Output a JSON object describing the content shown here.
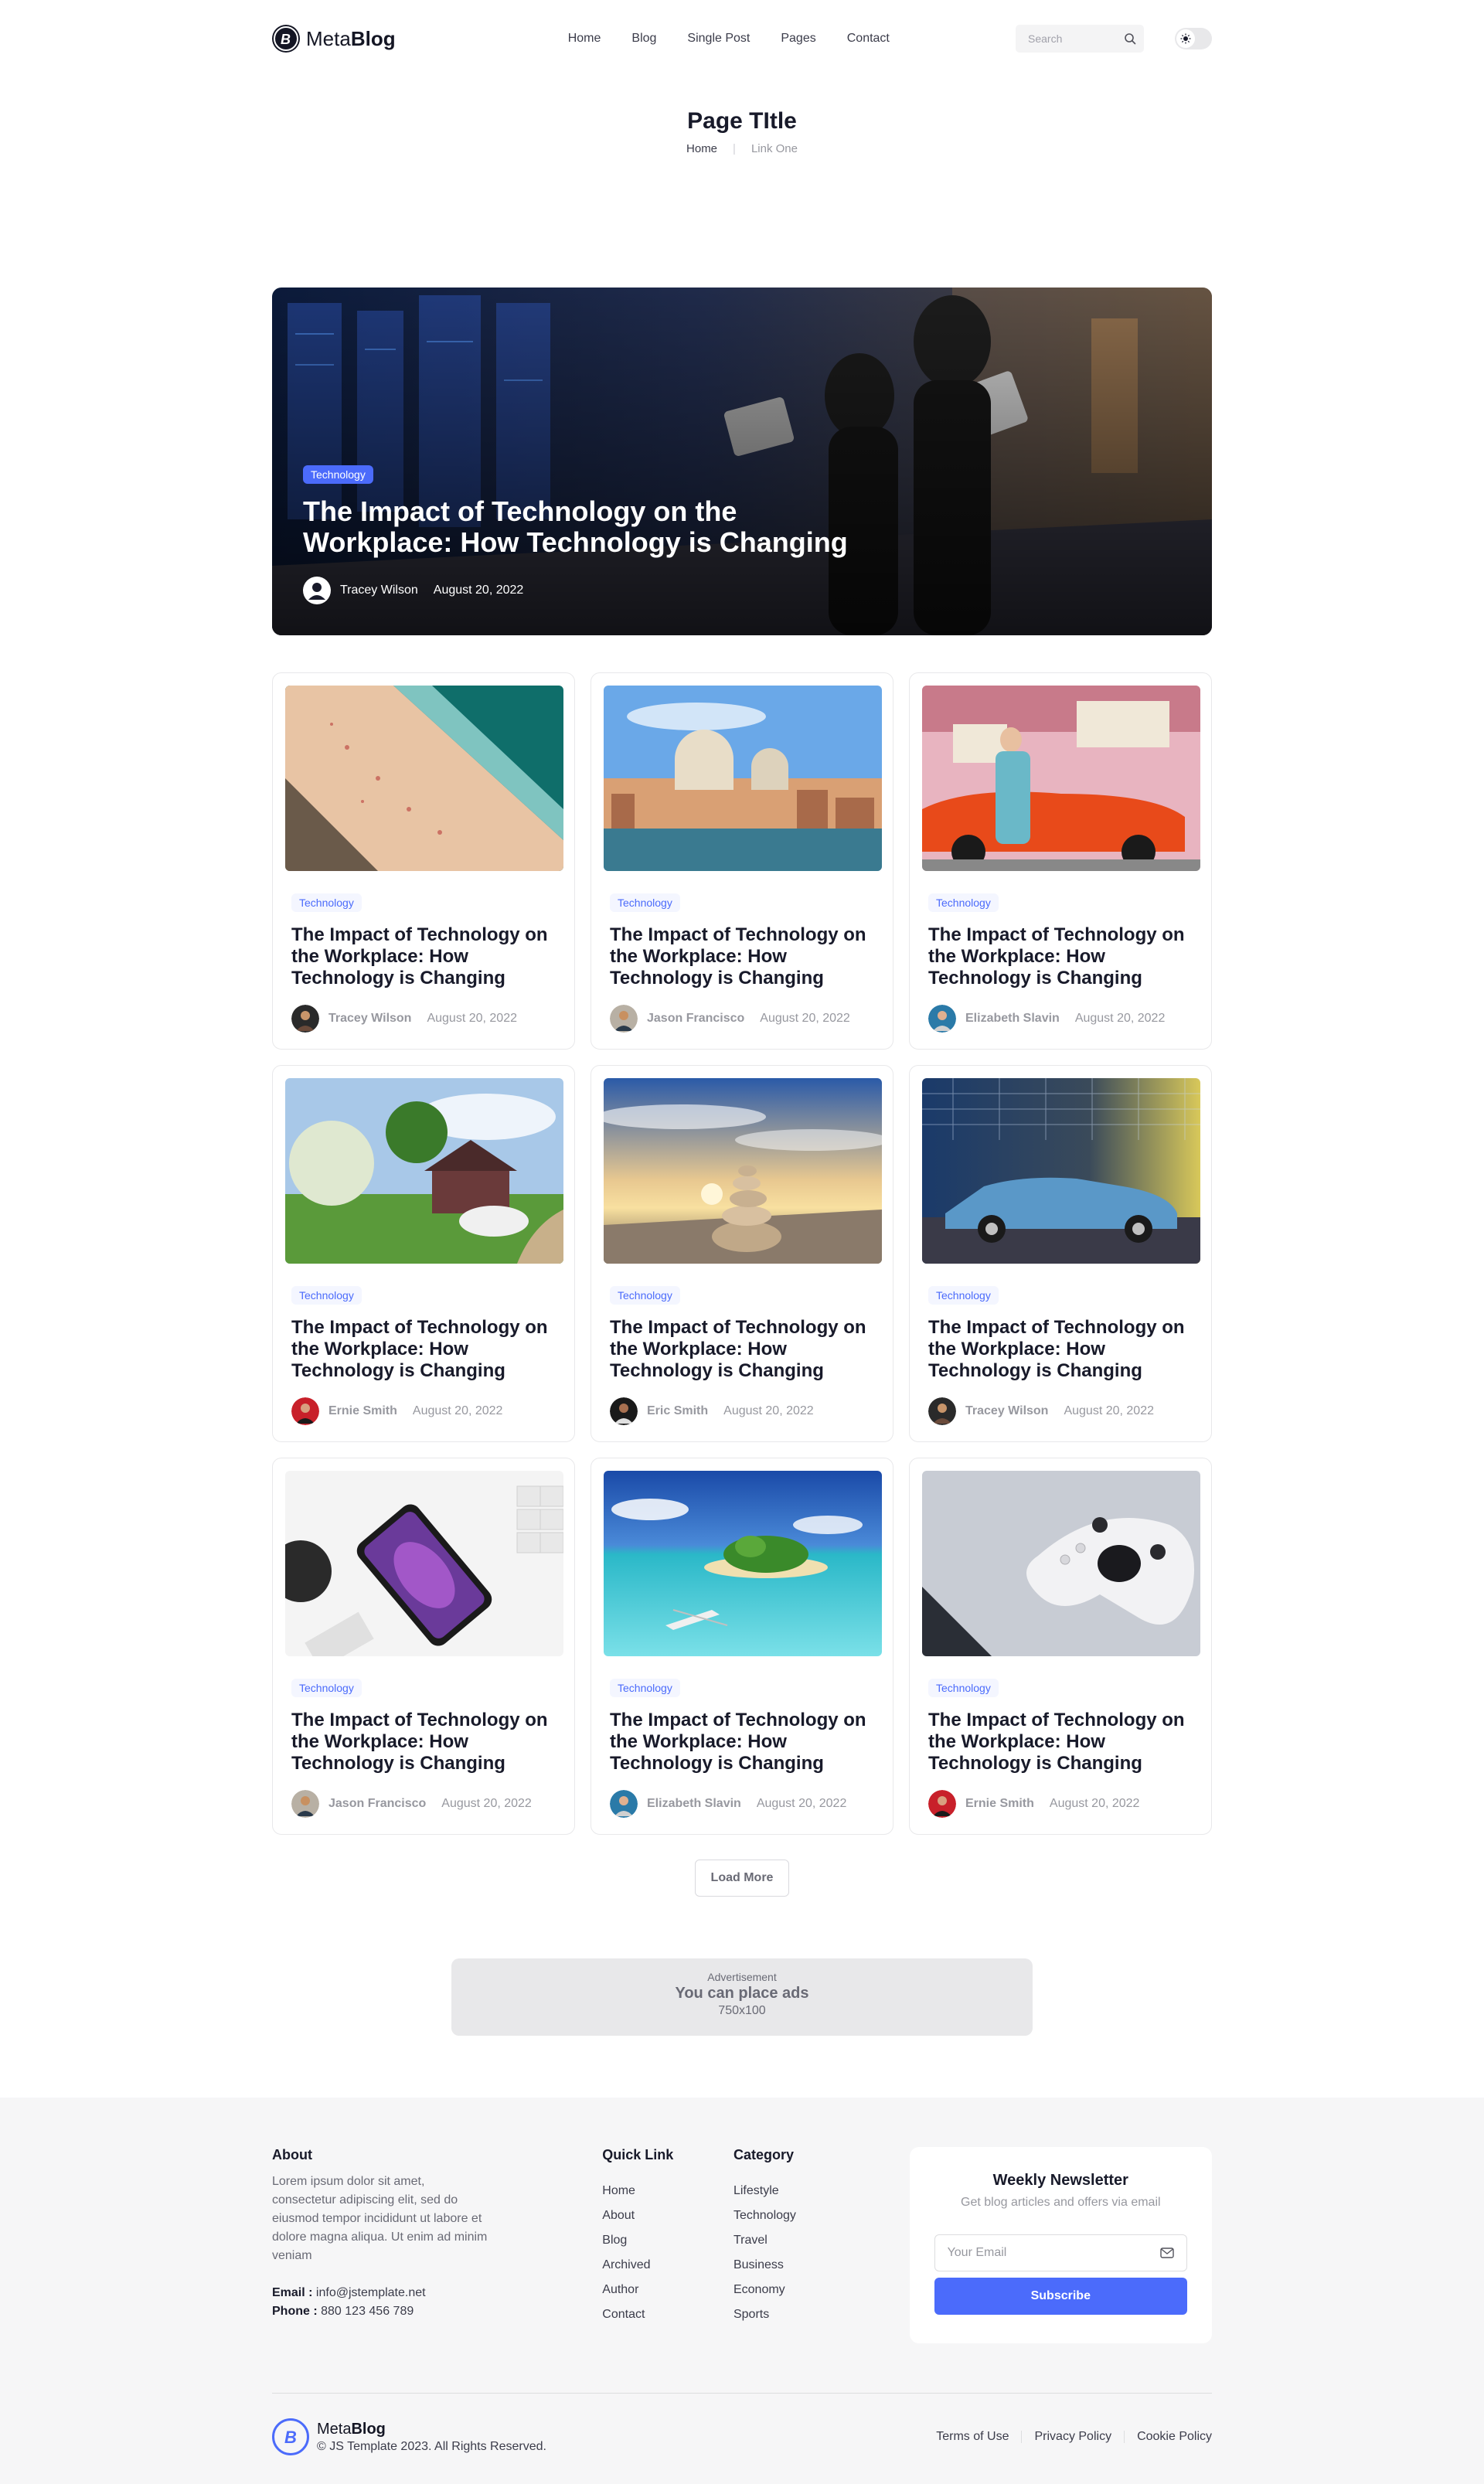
{
  "header": {
    "logo_light": "Meta",
    "logo_bold": "Blog",
    "nav": [
      "Home",
      "Blog",
      "Single Post",
      "Pages",
      "Contact"
    ],
    "search_placeholder": "Search"
  },
  "page": {
    "title": "Page TItle",
    "breadcrumb_current": "Home",
    "breadcrumb_link": "Link One"
  },
  "hero": {
    "tag": "Technology",
    "title": "The Impact of Technology on the Workplace: How Technology is Changing",
    "author": "Tracey Wilson",
    "date": "August 20, 2022"
  },
  "cards": [
    {
      "tag": "Technology",
      "title": "The Impact of Technology on the Workplace: How Technology is Changing",
      "author": "Tracey Wilson",
      "date": "August 20, 2022"
    },
    {
      "tag": "Technology",
      "title": "The Impact of Technology on the Workplace: How Technology is Changing",
      "author": "Jason Francisco",
      "date": "August 20, 2022"
    },
    {
      "tag": "Technology",
      "title": "The Impact of Technology on the Workplace: How Technology is Changing",
      "author": "Elizabeth Slavin",
      "date": "August 20, 2022"
    },
    {
      "tag": "Technology",
      "title": "The Impact of Technology on the Workplace: How Technology is Changing",
      "author": "Ernie Smith",
      "date": "August 20, 2022"
    },
    {
      "tag": "Technology",
      "title": "The Impact of Technology on the Workplace: How Technology is Changing",
      "author": "Eric Smith",
      "date": "August 20, 2022"
    },
    {
      "tag": "Technology",
      "title": "The Impact of Technology on the Workplace: How Technology is Changing",
      "author": "Tracey Wilson",
      "date": "August 20, 2022"
    },
    {
      "tag": "Technology",
      "title": "The Impact of Technology on the Workplace: How Technology is Changing",
      "author": "Jason Francisco",
      "date": "August 20, 2022"
    },
    {
      "tag": "Technology",
      "title": "The Impact of Technology on the Workplace: How Technology is Changing",
      "author": "Elizabeth Slavin",
      "date": "August 20, 2022"
    },
    {
      "tag": "Technology",
      "title": "The Impact of Technology on the Workplace: How Technology is Changing",
      "author": "Ernie Smith",
      "date": "August 20, 2022"
    }
  ],
  "load_more": "Load More",
  "ad": {
    "label": "Advertisement",
    "text": "You can place ads",
    "size": "750x100"
  },
  "footer": {
    "about_title": "About",
    "about_text": "Lorem ipsum dolor sit amet, consectetur adipiscing elit, sed do eiusmod tempor incididunt ut labore et dolore magna aliqua. Ut enim ad minim veniam",
    "email_label": "Email :",
    "email": "info@jstemplate.net",
    "phone_label": "Phone :",
    "phone": "880 123 456 789",
    "quick_title": "Quick Link",
    "quick_links": [
      "Home",
      "About",
      "Blog",
      "Archived",
      "Author",
      "Contact"
    ],
    "category_title": "Category",
    "categories": [
      "Lifestyle",
      "Technology",
      "Travel",
      "Business",
      "Economy",
      "Sports"
    ],
    "newsletter_title": "Weekly Newsletter",
    "newsletter_sub": "Get blog articles and offers via email",
    "email_placeholder": "Your Email",
    "subscribe": "Subscribe",
    "brand_light": "Meta",
    "brand_bold": "Blog",
    "copyright": "© JS Template 2023. All Rights Reserved.",
    "legal": [
      "Terms of Use",
      "Privacy Policy",
      "Cookie Policy"
    ]
  },
  "colors": {
    "accent": "#4B6BFB",
    "text": "#181A2A",
    "muted": "#97989F",
    "footer_bg": "#F6F6F7"
  }
}
